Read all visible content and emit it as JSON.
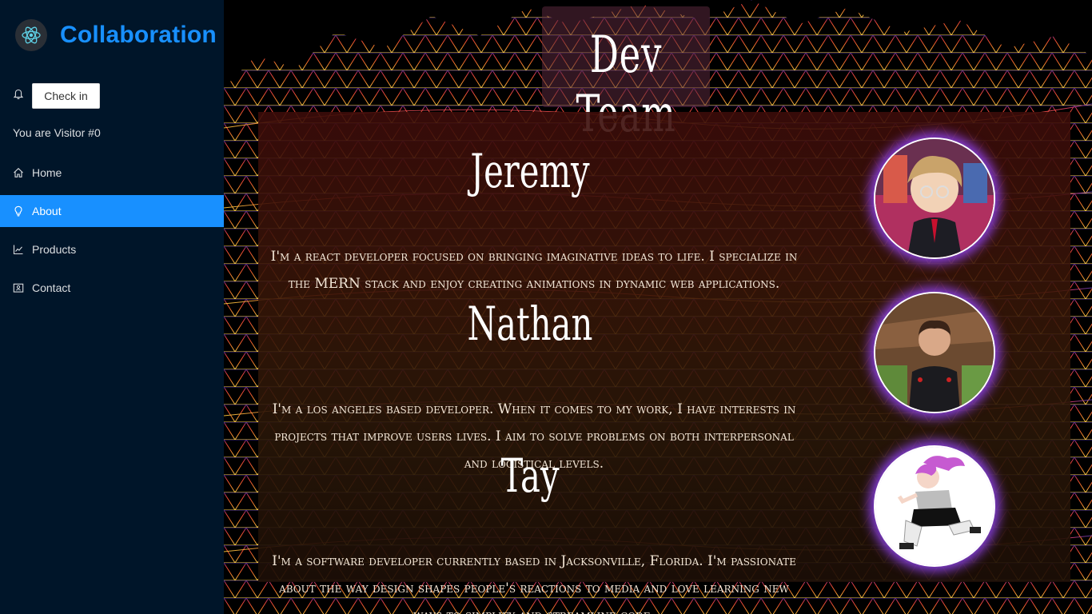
{
  "app": {
    "title": "Collaboration",
    "logo_icon": "atom-icon"
  },
  "sidebar": {
    "checkin_label": "Check in",
    "visitor_text": "You are Visitor #0",
    "items": [
      {
        "label": "Home",
        "icon": "home-icon"
      },
      {
        "label": "About",
        "icon": "bulb-icon",
        "active": true
      },
      {
        "label": "Products",
        "icon": "chart-icon"
      },
      {
        "label": "Contact",
        "icon": "contact-card-icon"
      }
    ]
  },
  "page": {
    "title": "Dev Team",
    "members": [
      {
        "name": "Jeremy",
        "bio": "I'm a react developer focused on bringing imaginative ideas to life. I specialize in the MERN stack and enjoy creating animations in dynamic web applications."
      },
      {
        "name": "Nathan",
        "bio": "I'm a los angeles based developer. When it comes to my work, I have interests in projects that improve users lives. I aim to solve problems on both interpersonal and logistical levels."
      },
      {
        "name": "Tay",
        "bio": "I'm a software developer currently based in Jacksonville, Florida. I'm passionate about the way design shapes people's reactions to media and love learning new ways to simplify and streamline code."
      }
    ]
  },
  "colors": {
    "sidebar_bg": "#001529",
    "accent": "#1890ff",
    "glow": "#9646ff"
  }
}
